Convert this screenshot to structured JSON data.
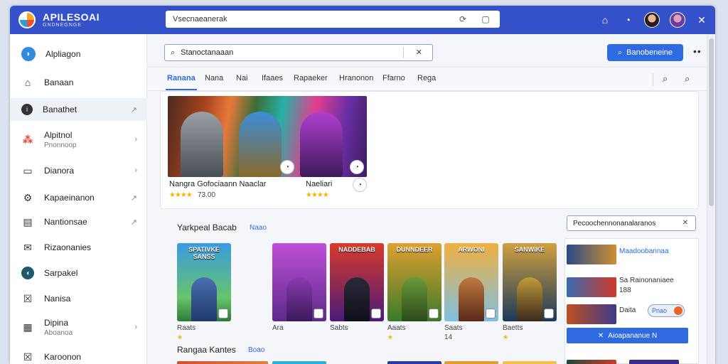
{
  "app": {
    "title": "APILESOAI",
    "subtitle": "GNDNEGNGE"
  },
  "addressbar": {
    "text": "Vsecnaeanerak"
  },
  "titlebar": {
    "icons": [
      "extension-icon",
      "chat-icon",
      "user-avatar",
      "user-avatar-2",
      "close-icon"
    ]
  },
  "sidebar": {
    "items": [
      {
        "label": "Alpliagon",
        "icon": "app-logo-icon"
      },
      {
        "label": "Banaan",
        "icon": "home-icon"
      },
      {
        "label": "Banathet",
        "icon": "info-icon",
        "arrow": "↗"
      },
      {
        "label": "Alpitnol",
        "sub": "Pnonnoop",
        "icon": "colorful-apps-icon",
        "arrow": "›"
      },
      {
        "label": "Dianora",
        "icon": "laptop-icon",
        "arrow": "›"
      },
      {
        "label": "Kapaeinanon",
        "icon": "gear-icon",
        "arrow": "↗"
      },
      {
        "label": "Nantionsae",
        "icon": "calendar-icon",
        "arrow": "↗"
      },
      {
        "label": "Rizaonanies",
        "icon": "mail-icon"
      },
      {
        "label": "Sarpakel",
        "icon": "chat-bubble-icon"
      },
      {
        "label": "Nanisa",
        "icon": "close-box-icon"
      },
      {
        "label": "Dipina",
        "sub": "Aboanoa",
        "icon": "grid-icon",
        "arrow": "›"
      },
      {
        "label": "Karoonon",
        "icon": "cross-box-icon"
      }
    ]
  },
  "search": {
    "placeholder": "Stanoctanaaan"
  },
  "action_button": {
    "label": "Banobeneine"
  },
  "tabs": [
    "Ranana",
    "Nana",
    "Nai",
    "Ifaaes",
    "Rapaeker",
    "Hranonon",
    "Ffarno",
    "Rega"
  ],
  "featured": {
    "items": [
      {
        "title": "Nangra Gofociaann Naaclar",
        "rating": "★★★★",
        "score": "73.00"
      },
      {
        "title": "Naeliari",
        "rating": "★★★★",
        "score": ""
      }
    ]
  },
  "section1": {
    "title": "Yarkpeal Bacab",
    "link": "Naao"
  },
  "cards": [
    {
      "title": "SPATIVKE SANSS",
      "caption": "Raats",
      "star": "★"
    },
    {
      "title": "",
      "caption": "Ara",
      "star": ""
    },
    {
      "title": "NADDEBAB",
      "caption": "Sabts",
      "star": ""
    },
    {
      "title": "DUNNDEER",
      "caption": "Aaats",
      "star": "★"
    },
    {
      "title": "ARWONI",
      "caption": "Saats",
      "star": "",
      "num": "14"
    },
    {
      "title": "SANWIKE",
      "caption": "Baetts",
      "star": "★"
    }
  ],
  "section2": {
    "title": "Rangaa Kantes",
    "link": "Boao"
  },
  "side_search": {
    "placeholder": "Pecoochennonanalaranos"
  },
  "rpanel": {
    "items": [
      {
        "text": "Maadoobannaa",
        "blue": true
      },
      {
        "text": "Sa Rainonaniaee",
        "sub": "188"
      },
      {
        "text": "Daita",
        "pill": "Pnao"
      }
    ],
    "button": "Aioapananue N"
  },
  "colors": {
    "accent": "#2f6ae0",
    "titlebar": "#3551c9",
    "star": "#f4b400"
  }
}
